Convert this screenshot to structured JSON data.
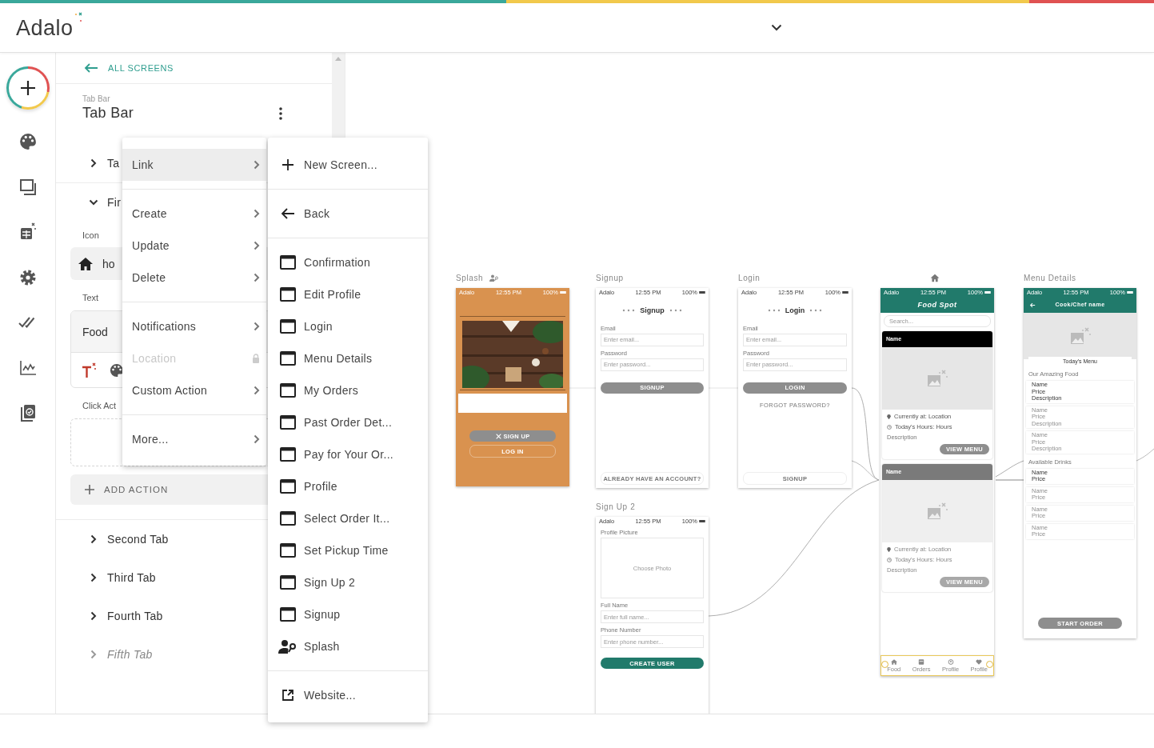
{
  "app": {
    "logo": "Adalo"
  },
  "panel": {
    "back_link": "ALL SCREENS",
    "caption": "Tab Bar",
    "title": "Tab Bar",
    "tabs": [
      {
        "label": "Ta",
        "expanded": false,
        "disabled": false
      },
      {
        "label": "Fir",
        "expanded": true,
        "disabled": false,
        "properties": {
          "icon_label": "Icon",
          "icon_value": "ho",
          "text_label": "Text",
          "text_value": "Food",
          "click_label": "Click Act",
          "add_action": "ADD ACTION"
        }
      },
      {
        "label": "Second Tab",
        "expanded": false,
        "disabled": false
      },
      {
        "label": "Third Tab",
        "expanded": false,
        "disabled": false
      },
      {
        "label": "Fourth Tab",
        "expanded": false,
        "disabled": false
      },
      {
        "label": "Fifth Tab",
        "expanded": false,
        "disabled": true
      }
    ]
  },
  "action_menu": {
    "groups": [
      [
        {
          "label": "Link",
          "selected": true,
          "disabled": false
        }
      ],
      [
        {
          "label": "Create",
          "selected": false,
          "disabled": false
        },
        {
          "label": "Update",
          "selected": false,
          "disabled": false
        },
        {
          "label": "Delete",
          "selected": false,
          "disabled": false
        }
      ],
      [
        {
          "label": "Notifications",
          "selected": false,
          "disabled": false
        },
        {
          "label": "Location",
          "selected": false,
          "disabled": true
        },
        {
          "label": "Custom Action",
          "selected": false,
          "disabled": false
        }
      ],
      [
        {
          "label": "More...",
          "selected": false,
          "disabled": false
        }
      ]
    ]
  },
  "link_menu": {
    "groups": [
      [
        {
          "label": "New Screen...",
          "kind": "add"
        }
      ],
      [
        {
          "label": "Back",
          "kind": "back"
        }
      ],
      [
        {
          "label": "Confirmation",
          "kind": "screen"
        },
        {
          "label": "Edit Profile",
          "kind": "screen"
        },
        {
          "label": "Login",
          "kind": "screen"
        },
        {
          "label": "Menu Details",
          "kind": "screen"
        },
        {
          "label": "My Orders",
          "kind": "screen"
        },
        {
          "label": "Past Order Det...",
          "kind": "screen"
        },
        {
          "label": "Pay for Your Or...",
          "kind": "screen"
        },
        {
          "label": "Profile",
          "kind": "screen"
        },
        {
          "label": "Select Order It...",
          "kind": "screen"
        },
        {
          "label": "Set Pickup Time",
          "kind": "screen"
        },
        {
          "label": "Sign Up 2",
          "kind": "screen"
        },
        {
          "label": "Signup",
          "kind": "screen"
        },
        {
          "label": "Splash",
          "kind": "start"
        }
      ],
      [
        {
          "label": "Website...",
          "kind": "external"
        }
      ]
    ]
  },
  "canvas": {
    "screens": [
      {
        "title": "Splash",
        "kind": "splash",
        "home": false,
        "login_start": true,
        "content": [
          {
            "kind": "status",
            "carrier": "Adalo",
            "time": "12:55 PM",
            "battery": "100%"
          },
          {
            "kind": "rule"
          },
          {
            "kind": "picture"
          },
          {
            "kind": "rule"
          },
          {
            "kind": "blank-box"
          },
          {
            "kind": "button-icon",
            "text": "SIGN UP"
          },
          {
            "kind": "button-outline",
            "text": "LOG IN"
          }
        ]
      },
      {
        "title": "Signup",
        "kind": "plain",
        "home": false,
        "login_start": false,
        "content": [
          {
            "kind": "status",
            "carrier": "Adalo",
            "time": "12:55 PM",
            "battery": "100%"
          },
          {
            "kind": "heading",
            "text": "Signup"
          },
          {
            "kind": "label",
            "text": "Email"
          },
          {
            "kind": "input",
            "text": "Enter email..."
          },
          {
            "kind": "label",
            "text": "Password"
          },
          {
            "kind": "input",
            "text": "Enter password..."
          },
          {
            "kind": "button-grey",
            "text": "SIGNUP"
          },
          {
            "kind": "footer-button",
            "text": "ALREADY HAVE AN ACCOUNT?"
          }
        ]
      },
      {
        "title": "Login",
        "kind": "plain",
        "home": false,
        "login_start": false,
        "content": [
          {
            "kind": "status",
            "carrier": "Adalo",
            "time": "12:55 PM",
            "battery": "100%"
          },
          {
            "kind": "heading",
            "text": "Login"
          },
          {
            "kind": "label",
            "text": "Email"
          },
          {
            "kind": "input",
            "text": "Enter email..."
          },
          {
            "kind": "label",
            "text": "Password"
          },
          {
            "kind": "input",
            "text": "Enter password..."
          },
          {
            "kind": "button-grey",
            "text": "LOGIN"
          },
          {
            "kind": "text-link",
            "text": "FORGOT PASSWORD?"
          },
          {
            "kind": "footer-button",
            "text": "SIGNUP"
          }
        ]
      },
      {
        "kind": "branded",
        "home": true,
        "login_start": false,
        "content": [
          {
            "kind": "status",
            "carrier": "Adalo",
            "time": "12:55 PM",
            "battery": "100%"
          },
          {
            "kind": "app-header",
            "text": "Food Spot",
            "back": false
          },
          {
            "kind": "search",
            "text": "Search..."
          },
          {
            "kind": "card",
            "header": "Name",
            "location": "Currently at: Location",
            "hours": "Today's Hours: Hours",
            "description": "Description",
            "button": "VIEW MENU",
            "faded": false
          },
          {
            "kind": "card",
            "header": "Name",
            "location": "Currently at: Location",
            "hours": "Today's Hours: Hours",
            "description": "Description",
            "button": "VIEW MENU",
            "faded": true
          },
          {
            "kind": "tab-bar",
            "items": [
              "Food",
              "Orders",
              "Profile",
              "Profile"
            ],
            "selected": true
          }
        ]
      },
      {
        "title": "Menu Details",
        "kind": "branded",
        "home": false,
        "login_start": false,
        "content": [
          {
            "kind": "status",
            "carrier": "Adalo",
            "time": "12:55 PM",
            "battery": "100%"
          },
          {
            "kind": "app-header",
            "text": "Cook/Chef name",
            "back": true
          },
          {
            "kind": "image-area"
          },
          {
            "kind": "title-card",
            "text": "Today's Menu"
          },
          {
            "kind": "label",
            "text": "Our Amazing Food"
          },
          {
            "kind": "item",
            "lines": [
              "Name",
              "Price",
              "Description"
            ],
            "faded": false
          },
          {
            "kind": "item",
            "lines": [
              "Name",
              "Price",
              "Description"
            ],
            "faded": true
          },
          {
            "kind": "item",
            "lines": [
              "Name",
              "Price",
              "Description"
            ],
            "faded": true
          },
          {
            "kind": "label",
            "text": "Available Drinks"
          },
          {
            "kind": "item",
            "lines": [
              "Name",
              "Price"
            ],
            "faded": false
          },
          {
            "kind": "item",
            "lines": [
              "Name",
              "Price"
            ],
            "faded": true
          },
          {
            "kind": "item",
            "lines": [
              "Name",
              "Price"
            ],
            "faded": true
          },
          {
            "kind": "item",
            "lines": [
              "Name",
              "Price"
            ],
            "faded": true
          },
          {
            "kind": "button-grey",
            "text": "START ORDER"
          }
        ]
      },
      {
        "title": "Sign Up 2",
        "kind": "plain",
        "home": false,
        "login_start": false,
        "content": [
          {
            "kind": "status",
            "carrier": "Adalo",
            "time": "12:55 PM",
            "battery": "100%"
          },
          {
            "kind": "label",
            "text": "Profile Picture"
          },
          {
            "kind": "photo-picker",
            "text": "Choose Photo"
          },
          {
            "kind": "label",
            "text": "Full Name"
          },
          {
            "kind": "input",
            "text": "Enter full name..."
          },
          {
            "kind": "label",
            "text": "Phone Number"
          },
          {
            "kind": "input",
            "text": "Enter phone number..."
          },
          {
            "kind": "button-green",
            "text": "CREATE USER"
          }
        ]
      }
    ]
  }
}
